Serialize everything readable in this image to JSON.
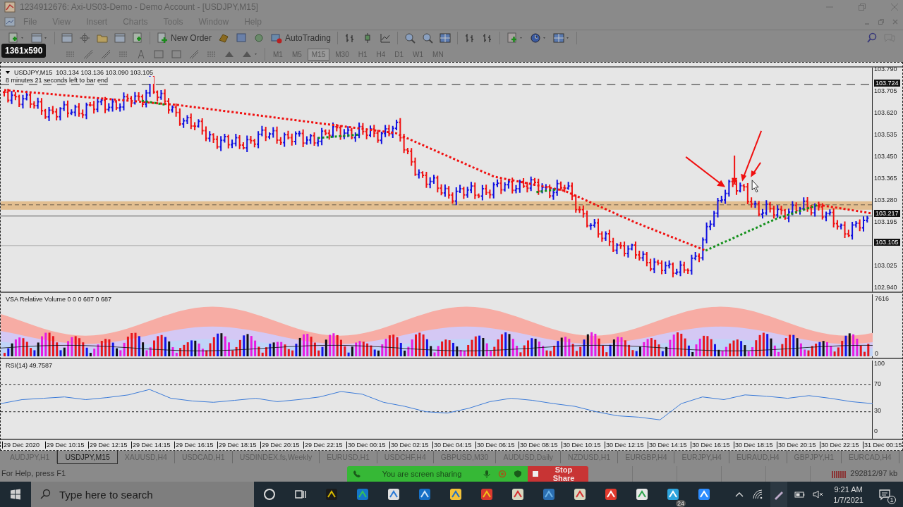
{
  "window": {
    "title": "1234912676: Axi-US03-Demo - Demo Account - [USDJPY,M15]"
  },
  "menu": [
    "File",
    "View",
    "Insert",
    "Charts",
    "Tools",
    "Window",
    "Help"
  ],
  "toolbar": {
    "new_order": "New Order",
    "auto_trading": "AutoTrading"
  },
  "size_tooltip": "1361x590",
  "timeframes": [
    {
      "label": "M1",
      "selected": false
    },
    {
      "label": "M5",
      "selected": false
    },
    {
      "label": "M15",
      "selected": true
    },
    {
      "label": "M30",
      "selected": false
    },
    {
      "label": "H1",
      "selected": false
    },
    {
      "label": "H4",
      "selected": false
    },
    {
      "label": "D1",
      "selected": false
    },
    {
      "label": "W1",
      "selected": false
    },
    {
      "label": "MN",
      "selected": false
    }
  ],
  "chart": {
    "symbol_line": "USDJPY,M15  103.134 103.136 103.090 103.105",
    "timer": "8 minutes 21 seconds left to bar end",
    "price_ticks": [
      "103.790",
      "103.705",
      "103.620",
      "103.535",
      "103.450",
      "103.365",
      "103.280",
      "103.195",
      "103.025",
      "102.940"
    ],
    "price_labels": [
      "103.724",
      "103.217",
      "103.105"
    ]
  },
  "volume_pane": {
    "label": "VSA Relative Volume 0 0 0 687 0 687",
    "ticks": [
      "7616",
      "0"
    ]
  },
  "rsi_pane": {
    "label": "RSI(14) 49.7587",
    "chart_data": {
      "type": "line",
      "ylim": [
        -10,
        106
      ],
      "yticks": [
        0,
        30,
        70,
        100
      ],
      "values": [
        42,
        48,
        50,
        52,
        48,
        51,
        55,
        63,
        50,
        46,
        44,
        47,
        50,
        45,
        48,
        52,
        60,
        56,
        44,
        38,
        30,
        28,
        35,
        45,
        50,
        47,
        42,
        38,
        30,
        24,
        22,
        18,
        42,
        52,
        48,
        55,
        53,
        50,
        54,
        50,
        45,
        42
      ]
    }
  },
  "time_axis": [
    "29 Dec 2020",
    "29 Dec 10:15",
    "29 Dec 12:15",
    "29 Dec 14:15",
    "29 Dec 16:15",
    "29 Dec 18:15",
    "29 Dec 20:15",
    "29 Dec 22:15",
    "30 Dec 00:15",
    "30 Dec 02:15",
    "30 Dec 04:15",
    "30 Dec 06:15",
    "30 Dec 08:15",
    "30 Dec 10:15",
    "30 Dec 12:15",
    "30 Dec 14:15",
    "30 Dec 16:15",
    "30 Dec 18:15",
    "30 Dec 20:15",
    "30 Dec 22:15",
    "31 Dec 00:15"
  ],
  "tabs": [
    {
      "label": "AUDJPY,H1",
      "selected": false
    },
    {
      "label": "USDJPY,M15",
      "selected": true
    },
    {
      "label": "XAUUSD,H4",
      "selected": false
    },
    {
      "label": "USDCAD,H1",
      "selected": false
    },
    {
      "label": "USDINDEX.fs,Weekly",
      "selected": false
    },
    {
      "label": "EURUSD,H1",
      "selected": false
    },
    {
      "label": "USDCHF,H4",
      "selected": false
    },
    {
      "label": "GBPUSD,M30",
      "selected": false
    },
    {
      "label": "AUDUSD,Daily",
      "selected": false
    },
    {
      "label": "NZDUSD,H1",
      "selected": false
    },
    {
      "label": "EURGBP,H4",
      "selected": false
    },
    {
      "label": "EURJPY,H4",
      "selected": false
    },
    {
      "label": "EURAUD,H4",
      "selected": false
    },
    {
      "label": "GBPJPY,H1",
      "selected": false
    },
    {
      "label": "EURCAD,H4",
      "selected": false
    }
  ],
  "status_bar": {
    "help": "For Help, press F1",
    "memory": "292812/97 kb"
  },
  "screen_share": {
    "message": "You are screen sharing",
    "stop": "Stop Share"
  },
  "taskbar": {
    "search_placeholder": "Type here to search",
    "telegram_badge": "24",
    "time": "9:21 AM",
    "date": "1/7/2021",
    "notifications": "1"
  }
}
